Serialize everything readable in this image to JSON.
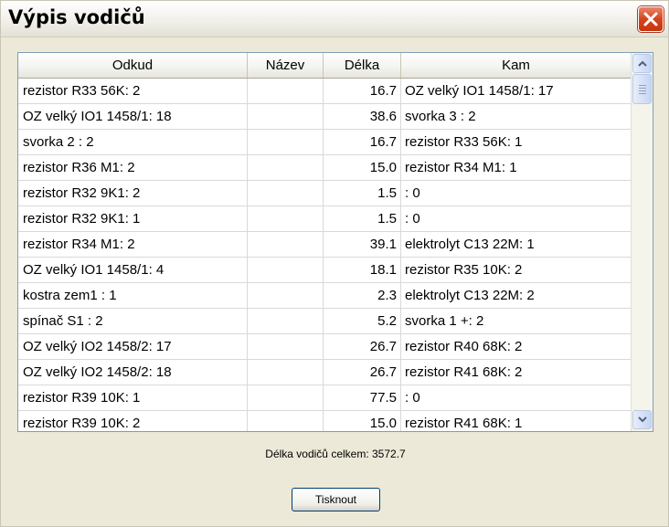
{
  "window": {
    "title": "Výpis vodičů"
  },
  "table": {
    "columns": [
      "Odkud",
      "Název",
      "Délka",
      "Kam"
    ],
    "rows": [
      {
        "from": "rezistor R33 56K: 2",
        "name": "",
        "length": "16.7",
        "to": "OZ velký IO1 1458/1: 17"
      },
      {
        "from": "OZ velký IO1 1458/1: 18",
        "name": "",
        "length": "38.6",
        "to": "svorka 3 : 2"
      },
      {
        "from": "svorka 2 : 2",
        "name": "",
        "length": "16.7",
        "to": "rezistor R33 56K: 1"
      },
      {
        "from": "rezistor R36 M1: 2",
        "name": "",
        "length": "15.0",
        "to": "rezistor R34 M1: 1"
      },
      {
        "from": "rezistor R32 9K1: 2",
        "name": "",
        "length": "1.5",
        "to": ": 0"
      },
      {
        "from": "rezistor R32 9K1: 1",
        "name": "",
        "length": "1.5",
        "to": ": 0"
      },
      {
        "from": "rezistor R34 M1: 2",
        "name": "",
        "length": "39.1",
        "to": "elektrolyt C13 22M: 1"
      },
      {
        "from": "OZ velký IO1 1458/1: 4",
        "name": "",
        "length": "18.1",
        "to": "rezistor R35 10K: 2"
      },
      {
        "from": "kostra zem1 : 1",
        "name": "",
        "length": "2.3",
        "to": "elektrolyt C13 22M: 2"
      },
      {
        "from": "spínač S1 : 2",
        "name": "",
        "length": "5.2",
        "to": "svorka 1 +: 2"
      },
      {
        "from": "OZ velký IO2 1458/2: 17",
        "name": "",
        "length": "26.7",
        "to": "rezistor R40 68K: 2"
      },
      {
        "from": "OZ velký IO2 1458/2: 18",
        "name": "",
        "length": "26.7",
        "to": "rezistor R41 68K: 2"
      },
      {
        "from": "rezistor R39 10K: 1",
        "name": "",
        "length": "77.5",
        "to": ": 0"
      },
      {
        "from": "rezistor R39 10K: 2",
        "name": "",
        "length": "15.0",
        "to": "rezistor R41 68K: 1"
      }
    ]
  },
  "footer": {
    "total_text": "Délka vodičů celkem: 3572.7",
    "print_label": "Tisknout"
  },
  "icons": {
    "close": "close-icon",
    "scroll_up": "chevron-up-icon",
    "scroll_down": "chevron-down-icon"
  },
  "colors": {
    "close_button": "#d6441e",
    "list_border": "#7f9db9"
  }
}
